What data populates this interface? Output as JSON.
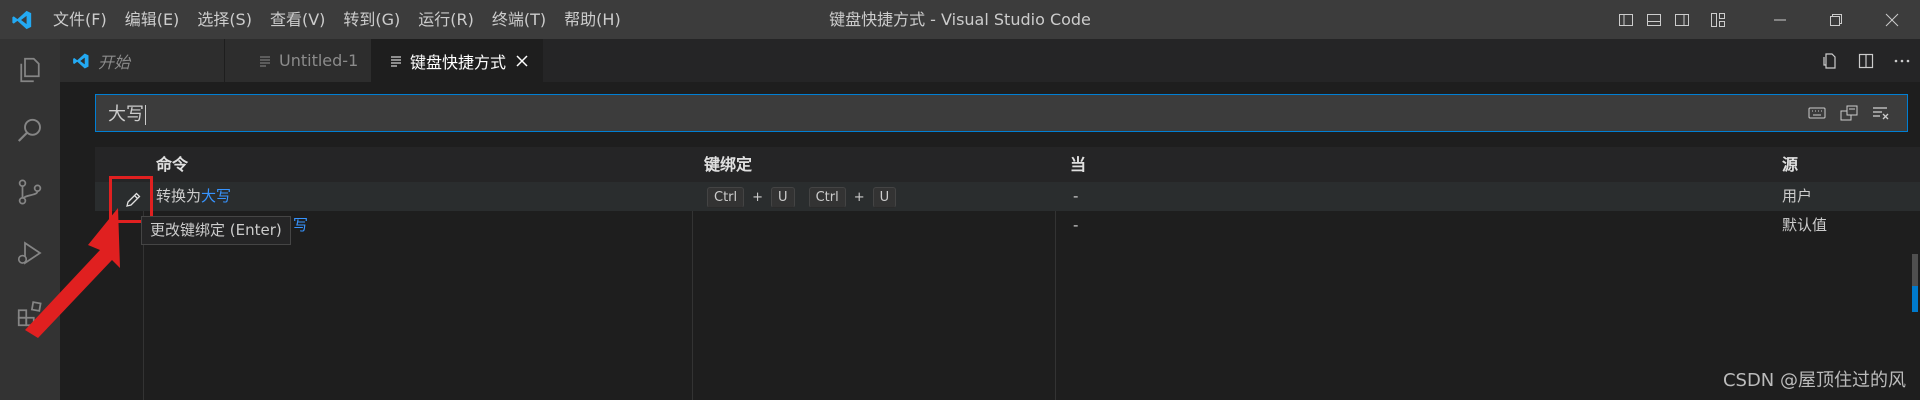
{
  "menu": [
    "文件(F)",
    "编辑(E)",
    "选择(S)",
    "查看(V)",
    "转到(G)",
    "运行(R)",
    "终端(T)",
    "帮助(H)"
  ],
  "window_title": "键盘快捷方式 - Visual Studio Code",
  "tabs": [
    {
      "label": "开始",
      "icon": "vscode-logo-icon",
      "active": false
    },
    {
      "label": "Untitled-1",
      "icon": "file-lines-icon",
      "active": false
    },
    {
      "label": "键盘快捷方式",
      "icon": "file-lines-icon",
      "active": true
    }
  ],
  "search": {
    "value": "大写"
  },
  "table": {
    "headers": {
      "command": "命令",
      "keybinding": "键绑定",
      "when": "当",
      "source": "源"
    },
    "rows": [
      {
        "command_prefix": "转换为",
        "command_match": "大写",
        "keys": [
          [
            "Ctrl",
            "U"
          ],
          [
            "Ctrl",
            "U"
          ]
        ],
        "when": "-",
        "source": "用户"
      },
      {
        "command_prefix": "",
        "command_match": "写",
        "keys": [],
        "when": "-",
        "source": "默认值"
      }
    ]
  },
  "tooltip": "更改键绑定 (Enter)",
  "watermark": "CSDN @屋顶住过的风",
  "colors": {
    "accent": "#007acc",
    "highlight_text": "#3794ff",
    "annotation_red": "#e02020"
  }
}
